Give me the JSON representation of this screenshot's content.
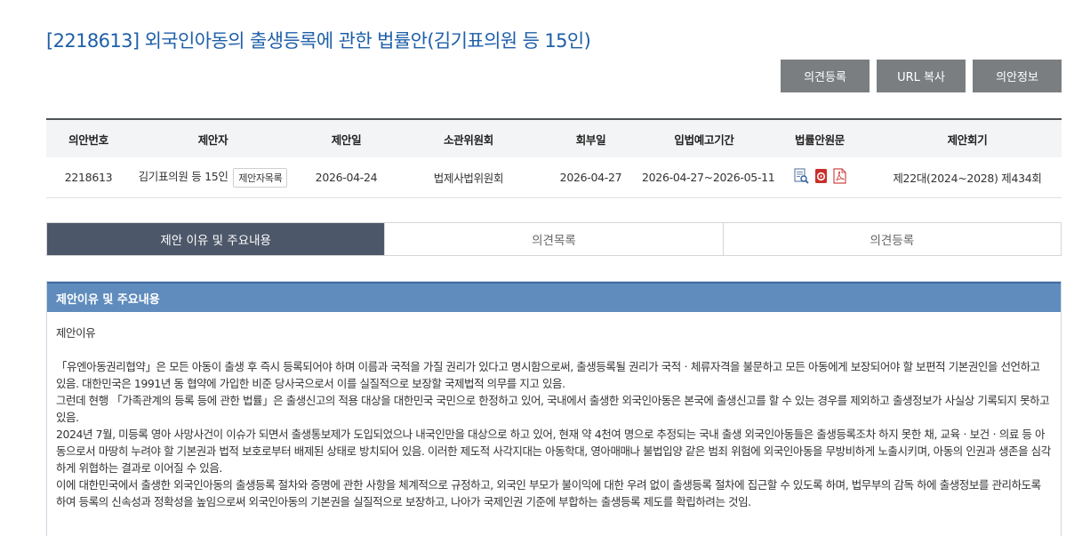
{
  "bill": {
    "title": "[2218613] 외국인아동의 출생등록에 관한 법률안(김기표의원 등 15인)"
  },
  "actions": {
    "opinion_register": "의견등록",
    "url_copy": "URL 복사",
    "bill_info": "의안정보"
  },
  "info_table": {
    "headers": [
      "의안번호",
      "제안자",
      "제안일",
      "소관위원회",
      "회부일",
      "입법예고기간",
      "법률안원문",
      "제안회기"
    ],
    "values": {
      "bill_no": "2218613",
      "proposer": "김기표의원 등 15인",
      "proposer_list_button": "제안자목록",
      "proposal_date": "2026-04-24",
      "committee": "법제사법위원회",
      "referral_date": "2026-04-27",
      "notice_period": "2026-04-27~2026-05-11",
      "session": "제22대(2024~2028) 제434회"
    },
    "doc_icons": [
      "document-view-icon",
      "hwp-file-icon",
      "pdf-file-icon"
    ]
  },
  "tabs": [
    "제안 이유 및 주요내용",
    "의견목록",
    "의견등록"
  ],
  "content": {
    "heading": "제안이유 및 주요내용",
    "subheading": "제안이유",
    "paragraphs": [
      "「유엔아동권리협약」은 모든 아동이 출생 후 즉시 등록되어야 하며 이름과 국적을 가질 권리가 있다고 명시함으로써, 출생등록될 권리가 국적ㆍ체류자격을 불문하고 모든 아동에게 보장되어야 할 보편적 기본권인을 선언하고 있음. 대한민국은 1991년 동 협약에 가입한 비준 당사국으로서 이를 실질적으로 보장할 국제법적 의무를 지고 있음.",
      "그런데 현행 「가족관계의 등록 등에 관한 법률」은 출생신고의 적용 대상을 대한민국 국민으로 한정하고 있어, 국내에서 출생한 외국인아동은 본국에 출생신고를 할 수 있는 경우를 제외하고 출생정보가 사실상 기록되지 못하고 있음.",
      "2024년 7월, 미등록 영아 사망사건이 이슈가 되면서 출생통보제가 도입되었으나 내국인만을 대상으로 하고 있어, 현재 약 4천여 명으로 추정되는 국내 출생 외국인아동들은 출생등록조차 하지 못한 채, 교육ㆍ보건ㆍ의료 등 아동으로서 마땅히 누려야 할 기본권과 법적 보호로부터 배제된 상태로 방치되어 있음. 이러한 제도적 사각지대는 아동학대, 영아매매나 불법입양 같은 범죄 위험에 외국인아동을 무방비하게 노출시키며, 아동의 인권과 생존을 심각하게 위협하는 결과로 이어질 수 있음.",
      "이에 대한민국에서 출생한 외국인아동의 출생등록 절차와 증명에 관한 사항을 체계적으로 규정하고, 외국인 부모가 불이익에 대한 우려 없이 출생등록 절차에 집근할 수 있도록 하며, 법무부의 감독 하에 출생정보를 관리하도록 하여 등록의 신속성과 정확성을 높임으로써 외국인아동의 기본권을 실질적으로 보장하고, 나아가 국제인권 기준에 부합하는 출생등록 제도를 확립하려는 것임."
    ]
  }
}
